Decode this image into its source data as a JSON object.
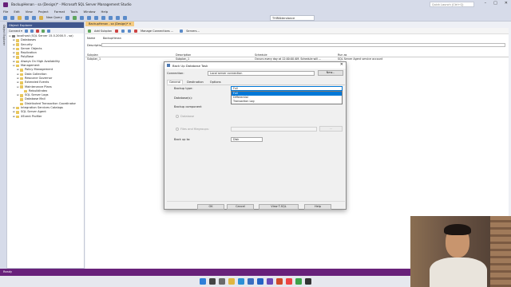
{
  "window": {
    "title": "BackupHenan - sa (Design)* - Microsoft SQL Server Management Studio",
    "quick_launch": "Quick Launch (Ctrl+Q)",
    "min": "–",
    "max": "□",
    "close": "✕"
  },
  "menu": [
    "File",
    "Edit",
    "View",
    "Project",
    "Format",
    "Tools",
    "Window",
    "Help"
  ],
  "toolbar": {
    "new_query": "New Query",
    "db_selector": "THIRAttendance"
  },
  "object_explorer": {
    "title": "Object Explorer",
    "connect": "Connect ▾",
    "side_label": "Object Explorer",
    "tree": [
      {
        "label": "localhost (SQL Server 15.0.2000.5 - sa)",
        "level": 0,
        "exp": "⊟",
        "kind": "server"
      },
      {
        "label": "Databases",
        "level": 1,
        "exp": "⊞",
        "kind": "folder"
      },
      {
        "label": "Security",
        "level": 1,
        "exp": "⊞",
        "kind": "folder"
      },
      {
        "label": "Server Objects",
        "level": 1,
        "exp": "⊞",
        "kind": "folder"
      },
      {
        "label": "Replication",
        "level": 1,
        "exp": "⊞",
        "kind": "folder"
      },
      {
        "label": "PolyBase",
        "level": 1,
        "exp": "⊞",
        "kind": "folder"
      },
      {
        "label": "Always On High Availability",
        "level": 1,
        "exp": "⊞",
        "kind": "folder"
      },
      {
        "label": "Management",
        "level": 1,
        "exp": "⊟",
        "kind": "folder"
      },
      {
        "label": "Policy Management",
        "level": 2,
        "exp": "⊞",
        "kind": "folder"
      },
      {
        "label": "Data Collection",
        "level": 2,
        "exp": "⊞",
        "kind": "folder"
      },
      {
        "label": "Resource Governor",
        "level": 2,
        "exp": "⊞",
        "kind": "folder"
      },
      {
        "label": "Extended Events",
        "level": 2,
        "exp": "⊞",
        "kind": "folder"
      },
      {
        "label": "Maintenance Plans",
        "level": 2,
        "exp": "⊟",
        "kind": "folder"
      },
      {
        "label": "RebuildIndex",
        "level": 3,
        "exp": "",
        "kind": "item"
      },
      {
        "label": "SQL Server Logs",
        "level": 2,
        "exp": "⊞",
        "kind": "folder"
      },
      {
        "label": "Database Mail",
        "level": 2,
        "exp": "",
        "kind": "item"
      },
      {
        "label": "Distributed Transaction Coordinator",
        "level": 2,
        "exp": "",
        "kind": "item"
      },
      {
        "label": "Integration Services Catalogs",
        "level": 1,
        "exp": "⊞",
        "kind": "folder"
      },
      {
        "label": "SQL Server Agent",
        "level": 1,
        "exp": "⊞",
        "kind": "folder"
      },
      {
        "label": "XEvent Profiler",
        "level": 1,
        "exp": "⊞",
        "kind": "folder"
      }
    ]
  },
  "document": {
    "tab": "BackupHenan - sa (Design)*  ✕",
    "bar": {
      "add_subplan": "Add Subplan",
      "manage_connections": "Manage Connections ...",
      "servers": "Servers..."
    },
    "name_label": "Name",
    "name_value": "BackupHenan",
    "description_label": "Description",
    "grid_headers": [
      "Subplan",
      "Description",
      "Schedule",
      "Run as"
    ],
    "grid_row": [
      "Subplan_1",
      "Subplan_1",
      "Occurs every day at 12:00:00 AM. Schedule will ...",
      "SQL Server Agent service account"
    ]
  },
  "status": "Ready",
  "dialog": {
    "title": "Back Up Database Task",
    "close": "✕",
    "connection_label": "Connection:",
    "connection_value": "Local server connection",
    "new_button": "New...",
    "tabs": [
      "General",
      "Destination",
      "Options"
    ],
    "backup_type_label": "Backup type:",
    "backup_type_value": "Full",
    "backup_type_options": [
      "Full",
      "Differential",
      "Transaction Log"
    ],
    "databases_label": "Database(s):",
    "backup_component_label": "Backup component",
    "database_radio": "Database",
    "files_radio": "Files and filegroups:",
    "ellipsis": "...",
    "backup_to_label": "Back up to:",
    "backup_to_value": "Disk",
    "buttons": {
      "ok": "OK",
      "cancel": "Cancel",
      "view_tsql": "View T-SQL",
      "help": "Help"
    }
  }
}
